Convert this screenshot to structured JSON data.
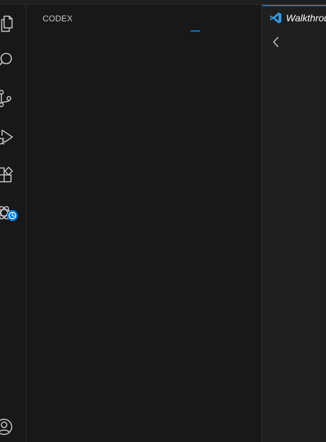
{
  "sidebar": {
    "title": "CODEX"
  },
  "activity_bar": {
    "items": [
      {
        "icon": "files-icon"
      },
      {
        "icon": "search-icon"
      },
      {
        "icon": "source-control-icon"
      },
      {
        "icon": "run-debug-icon"
      },
      {
        "icon": "extensions-icon"
      },
      {
        "icon": "codex-icon",
        "badge_icon": "clock-icon"
      }
    ],
    "bottom_items": [
      {
        "icon": "accounts-icon"
      }
    ]
  },
  "editor": {
    "tab": {
      "label": "Walkthrough",
      "icon": "vscode-logo-icon"
    },
    "back_icon": "chevron-left-icon"
  },
  "colors": {
    "accent": "#0078d4",
    "background": "#181818",
    "editor_background": "#1f1f1f",
    "icon": "#cccccc"
  }
}
